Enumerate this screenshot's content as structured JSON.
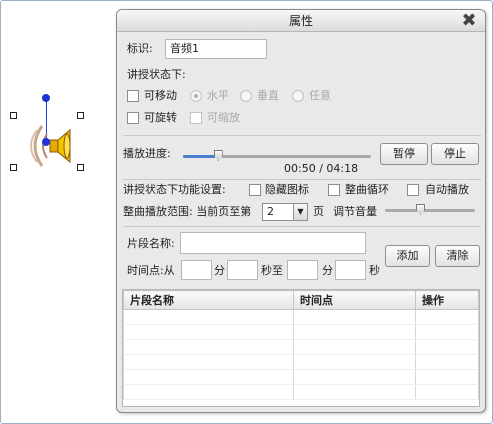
{
  "dialog": {
    "title": "属性",
    "close_icon": "close-icon"
  },
  "identity": {
    "label": "标识:",
    "value": "音频1"
  },
  "teaching": {
    "header": "讲授状态下:",
    "movable_label": "可移动",
    "horizontal_label": "水平",
    "vertical_label": "垂直",
    "any_label": "任意",
    "rotatable_label": "可旋转",
    "scalable_label": "可缩放"
  },
  "playback": {
    "progress_label": "播放进度:",
    "time_display": "00:50 / 04:18",
    "progress_fraction": 0.19,
    "pause_label": "暂停",
    "stop_label": "停止"
  },
  "function_settings": {
    "label": "讲授状态下功能设置:",
    "hide_icon_label": "隐藏图标",
    "loop_label": "整曲循环",
    "autoplay_label": "自动播放"
  },
  "range": {
    "label_prefix": "整曲播放范围: 当前页至第",
    "page_value": "2",
    "page_suffix": "页",
    "volume_label": "调节音量",
    "volume_fraction": 0.4
  },
  "segment": {
    "name_label": "片段名称:",
    "time_label": "时间点:从",
    "min_unit": "分",
    "sec_to": "秒至",
    "min_unit2": "分",
    "sec_unit": "秒",
    "add_label": "添加",
    "clear_label": "清除"
  },
  "table": {
    "columns": [
      "片段名称",
      "时间点",
      "操作"
    ],
    "rows": []
  },
  "colors": {
    "accent_blue": "#4a7fd0",
    "rotation_handle": "#1f34d6",
    "dialog_bg": "#e9e9e9"
  }
}
